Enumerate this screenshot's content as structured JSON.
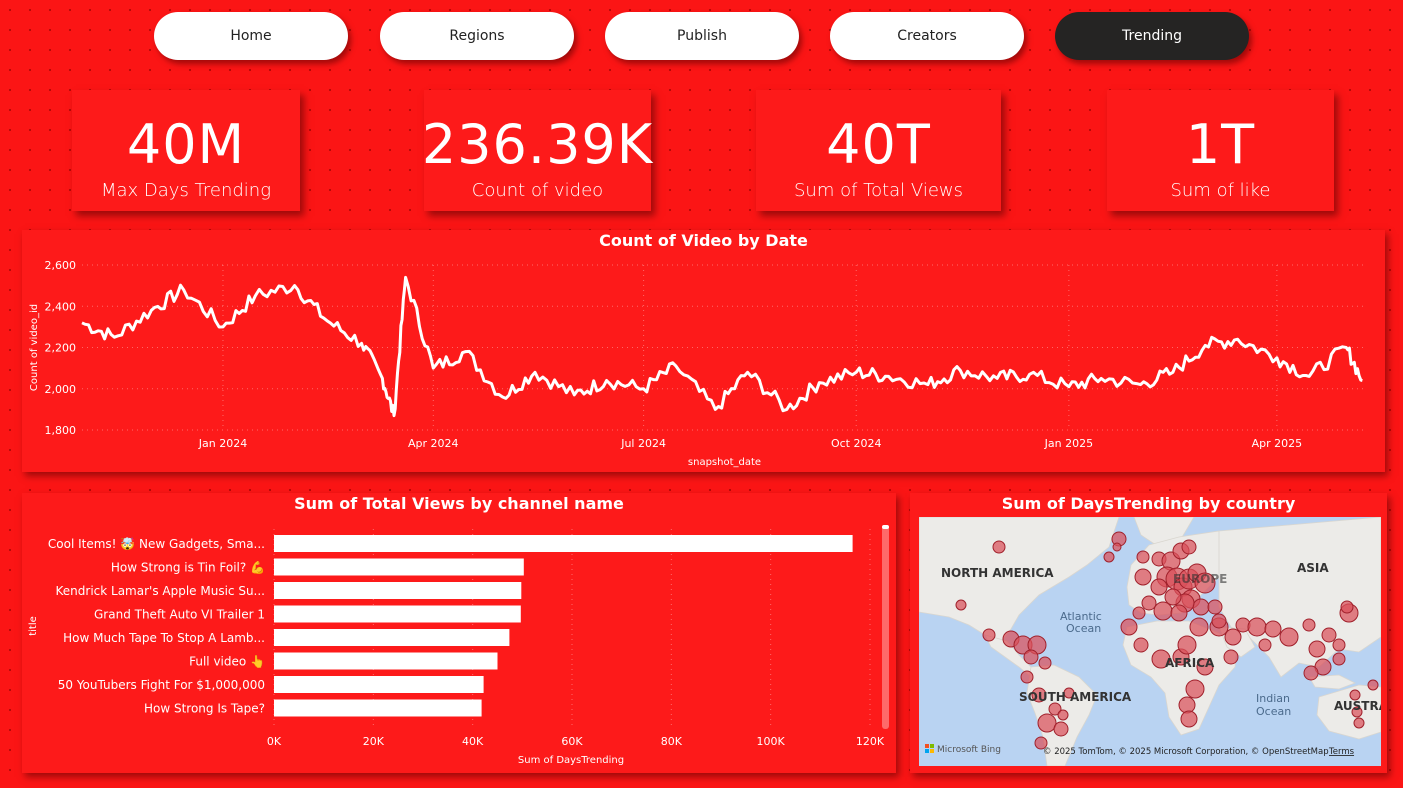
{
  "nav": {
    "items": [
      {
        "label": "Home",
        "active": false
      },
      {
        "label": "Regions",
        "active": false
      },
      {
        "label": "Publish",
        "active": false
      },
      {
        "label": "Creators",
        "active": false
      },
      {
        "label": "Trending",
        "active": true
      }
    ]
  },
  "kpis": [
    {
      "value": "40M",
      "label": "Max Days Trending"
    },
    {
      "value": "236.39K",
      "label": "Count of video"
    },
    {
      "value": "40T",
      "label": "Sum of Total Views"
    },
    {
      "value": "1T",
      "label": "Sum of like"
    }
  ],
  "line_chart": {
    "title": "Count of Video by Date",
    "xlabel": "snapshot_date",
    "ylabel": "Count of video_id",
    "y_ticks": [
      "1,800",
      "2,000",
      "2,200",
      "2,400",
      "2,600"
    ],
    "x_ticks": [
      "Jan 2024",
      "Apr 2024",
      "Jul 2024",
      "Oct 2024",
      "Jan 2025",
      "Apr 2025"
    ]
  },
  "bar_chart": {
    "title": "Sum of Total Views by channel name",
    "xlabel": "Sum of DaysTrending",
    "ylabel": "title",
    "x_ticks": [
      "0K",
      "20K",
      "40K",
      "60K",
      "80K",
      "100K",
      "120K"
    ]
  },
  "map": {
    "title": "Sum of DaysTrending by country",
    "labels": {
      "north_america": "NORTH AMERICA",
      "south_america": "SOUTH AMERICA",
      "europe": "EUROPE",
      "asia": "ASIA",
      "africa": "AFRICA",
      "australia": "AUSTRA",
      "atlantic1": "Atlantic",
      "atlantic2": "Ocean",
      "indian1": "Indian",
      "indian2": "Ocean"
    },
    "attribution": "© 2025 TomTom, © 2025 Microsoft Corporation, © OpenStreetMap",
    "terms": "Terms",
    "logo": "Microsoft Bing",
    "colors": {
      "bubble": "#d9505a",
      "bubble_stroke": "#a0202b",
      "water": "#b9d3f2",
      "land": "#ecebe8"
    }
  },
  "colors": {
    "background": "#fb1515",
    "panel": "#fd1a1a",
    "accent_dark": "#252423",
    "line": "#ffffff"
  },
  "chart_data": [
    {
      "type": "line",
      "title": "Count of Video by Date",
      "xlabel": "snapshot_date",
      "ylabel": "Count of video_id",
      "ylim": [
        1800,
        2600
      ],
      "x_range": [
        "2023-11-01",
        "2025-05-10"
      ],
      "x": [
        "2023-11-01",
        "2023-11-15",
        "2023-12-01",
        "2023-12-15",
        "2024-01-01",
        "2024-01-15",
        "2024-02-01",
        "2024-02-15",
        "2024-03-01",
        "2024-03-10",
        "2024-03-15",
        "2024-03-20",
        "2024-04-01",
        "2024-04-15",
        "2024-05-01",
        "2024-05-15",
        "2024-06-01",
        "2024-06-15",
        "2024-07-01",
        "2024-07-15",
        "2024-08-01",
        "2024-08-15",
        "2024-09-01",
        "2024-09-15",
        "2024-10-01",
        "2024-10-15",
        "2024-11-01",
        "2024-11-15",
        "2024-12-01",
        "2024-12-15",
        "2025-01-01",
        "2025-01-15",
        "2025-02-01",
        "2025-02-15",
        "2025-03-01",
        "2025-03-15",
        "2025-04-01",
        "2025-04-15",
        "2025-05-01",
        "2025-05-08"
      ],
      "y": [
        2320,
        2250,
        2380,
        2480,
        2300,
        2450,
        2500,
        2330,
        2220,
        2050,
        1870,
        2540,
        2100,
        2180,
        1960,
        2080,
        1970,
        2040,
        2000,
        2110,
        1900,
        2080,
        1900,
        2030,
        2080,
        2060,
        2020,
        2090,
        2050,
        2070,
        2010,
        2050,
        2020,
        2080,
        2210,
        2240,
        2150,
        2060,
        2200,
        2040
      ],
      "series": [
        {
          "values": [
            2320,
            2250,
            2380,
            2480,
            2300,
            2450,
            2500,
            2330,
            2220,
            2050,
            1870,
            2540,
            2100,
            2180,
            1960,
            2080,
            1970,
            2040,
            2000,
            2110,
            1900,
            2080,
            1900,
            2030,
            2080,
            2060,
            2020,
            2090,
            2050,
            2070,
            2010,
            2050,
            2020,
            2080,
            2210,
            2240,
            2150,
            2060,
            2200,
            2040
          ]
        }
      ]
    },
    {
      "type": "bar",
      "title": "Sum of Total Views by channel name",
      "xlabel": "Sum of DaysTrending",
      "ylabel": "title",
      "xlim": [
        0,
        120000
      ],
      "categories": [
        "Cool Items! 🤯 New Gadgets, Sma...",
        "How Strong is Tin Foil? 💪",
        "Kendrick Lamar's Apple Music Su...",
        "Grand Theft Auto VI Trailer 1",
        "How Much Tape To Stop A Lamb...",
        "Full video 👆",
        "50 YouTubers Fight For $1,000,000",
        "How Strong Is Tape?"
      ],
      "values": [
        116500,
        50300,
        49800,
        49700,
        47400,
        45000,
        42200,
        41800
      ]
    }
  ]
}
